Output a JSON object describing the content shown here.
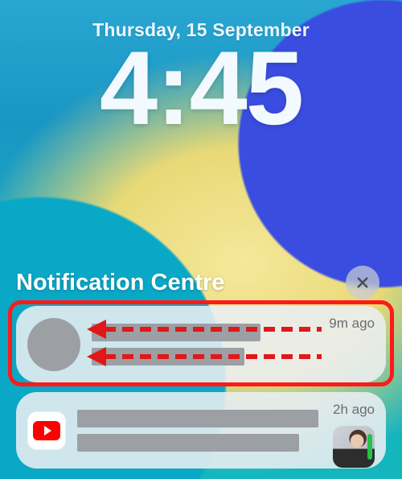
{
  "lockscreen": {
    "date": "Thursday, 15 September",
    "time": "4:45"
  },
  "notification_centre": {
    "title": "Notification Centre",
    "close_icon": "close-x"
  },
  "notifications": [
    {
      "app_icon": "generic-app",
      "timestamp": "9m ago"
    },
    {
      "app_icon": "youtube",
      "timestamp": "2h ago"
    }
  ],
  "annotation": {
    "highlight": "swipe-left-gesture",
    "arrows": 2
  }
}
